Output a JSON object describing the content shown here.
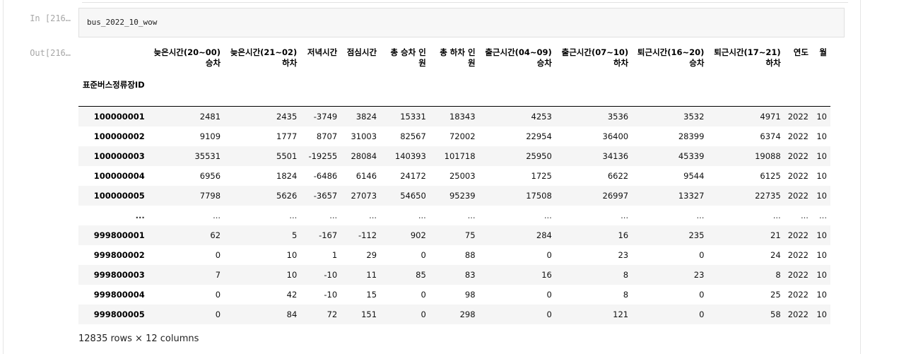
{
  "cell": {
    "in_prompt": "In [216…",
    "out_prompt": "Out[216…",
    "code": "bus_2022_10_wow"
  },
  "dataframe": {
    "index_name": "표준버스정류장ID",
    "columns": [
      "늦은시간(20~00) 승차",
      "늦은시간(21~02) 하차",
      "저녁시간",
      "점심시간",
      "총 승차 인원",
      "총 하차 인원",
      "출근시간(04~09) 승차",
      "출근시간(07~10) 하차",
      "퇴근시간(16~20) 승차",
      "퇴근시간(17~21) 하차",
      "연도",
      "월"
    ],
    "rows": [
      {
        "index": "100000001",
        "values": [
          "2481",
          "2435",
          "-3749",
          "3824",
          "15331",
          "18343",
          "4253",
          "3536",
          "3532",
          "4971",
          "2022",
          "10"
        ]
      },
      {
        "index": "100000002",
        "values": [
          "9109",
          "1777",
          "8707",
          "31003",
          "82567",
          "72002",
          "22954",
          "36400",
          "28399",
          "6374",
          "2022",
          "10"
        ]
      },
      {
        "index": "100000003",
        "values": [
          "35531",
          "5501",
          "-19255",
          "28084",
          "140393",
          "101718",
          "25950",
          "34136",
          "45339",
          "19088",
          "2022",
          "10"
        ]
      },
      {
        "index": "100000004",
        "values": [
          "6956",
          "1824",
          "-6486",
          "6146",
          "24172",
          "25003",
          "1725",
          "6622",
          "9544",
          "6125",
          "2022",
          "10"
        ]
      },
      {
        "index": "100000005",
        "values": [
          "7798",
          "5626",
          "-3657",
          "27073",
          "54650",
          "95239",
          "17508",
          "26997",
          "13327",
          "22735",
          "2022",
          "10"
        ]
      },
      {
        "index": "...",
        "values": [
          "...",
          "...",
          "...",
          "...",
          "...",
          "...",
          "...",
          "...",
          "...",
          "...",
          "...",
          "..."
        ]
      },
      {
        "index": "999800001",
        "values": [
          "62",
          "5",
          "-167",
          "-112",
          "902",
          "75",
          "284",
          "16",
          "235",
          "21",
          "2022",
          "10"
        ]
      },
      {
        "index": "999800002",
        "values": [
          "0",
          "10",
          "1",
          "29",
          "0",
          "88",
          "0",
          "23",
          "0",
          "24",
          "2022",
          "10"
        ]
      },
      {
        "index": "999800003",
        "values": [
          "7",
          "10",
          "-10",
          "11",
          "85",
          "83",
          "16",
          "8",
          "23",
          "8",
          "2022",
          "10"
        ]
      },
      {
        "index": "999800004",
        "values": [
          "0",
          "42",
          "-10",
          "15",
          "0",
          "98",
          "0",
          "8",
          "0",
          "25",
          "2022",
          "10"
        ]
      },
      {
        "index": "999800005",
        "values": [
          "0",
          "84",
          "72",
          "151",
          "0",
          "298",
          "0",
          "121",
          "0",
          "58",
          "2022",
          "10"
        ]
      }
    ],
    "summary": "12835 rows × 12 columns"
  }
}
